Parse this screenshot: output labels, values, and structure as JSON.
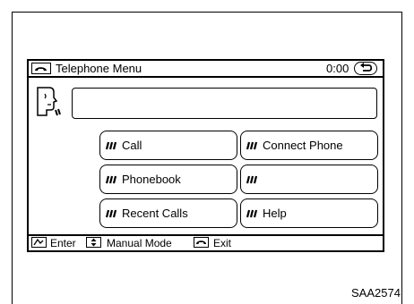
{
  "screen": {
    "title": "Telephone Menu",
    "timer": "0:00",
    "input_value": "",
    "buttons": [
      {
        "label": "Call"
      },
      {
        "label": "Connect Phone"
      },
      {
        "label": "Phonebook"
      },
      {
        "label": ""
      },
      {
        "label": "Recent Calls"
      },
      {
        "label": "Help"
      }
    ],
    "bottom": {
      "enter_label": "Enter",
      "manual_label": "Manual Mode",
      "exit_label": "Exit"
    }
  },
  "caption": "SAA2574",
  "icons": {
    "title": "phone-handset-icon",
    "back": "back-arrow-icon",
    "voice": "voice-recognition-head-icon",
    "voice_marks": "voice-command-icon",
    "enter": "touch-enter-icon",
    "manual": "scroll-knob-icon",
    "exit": "hang-up-icon"
  }
}
